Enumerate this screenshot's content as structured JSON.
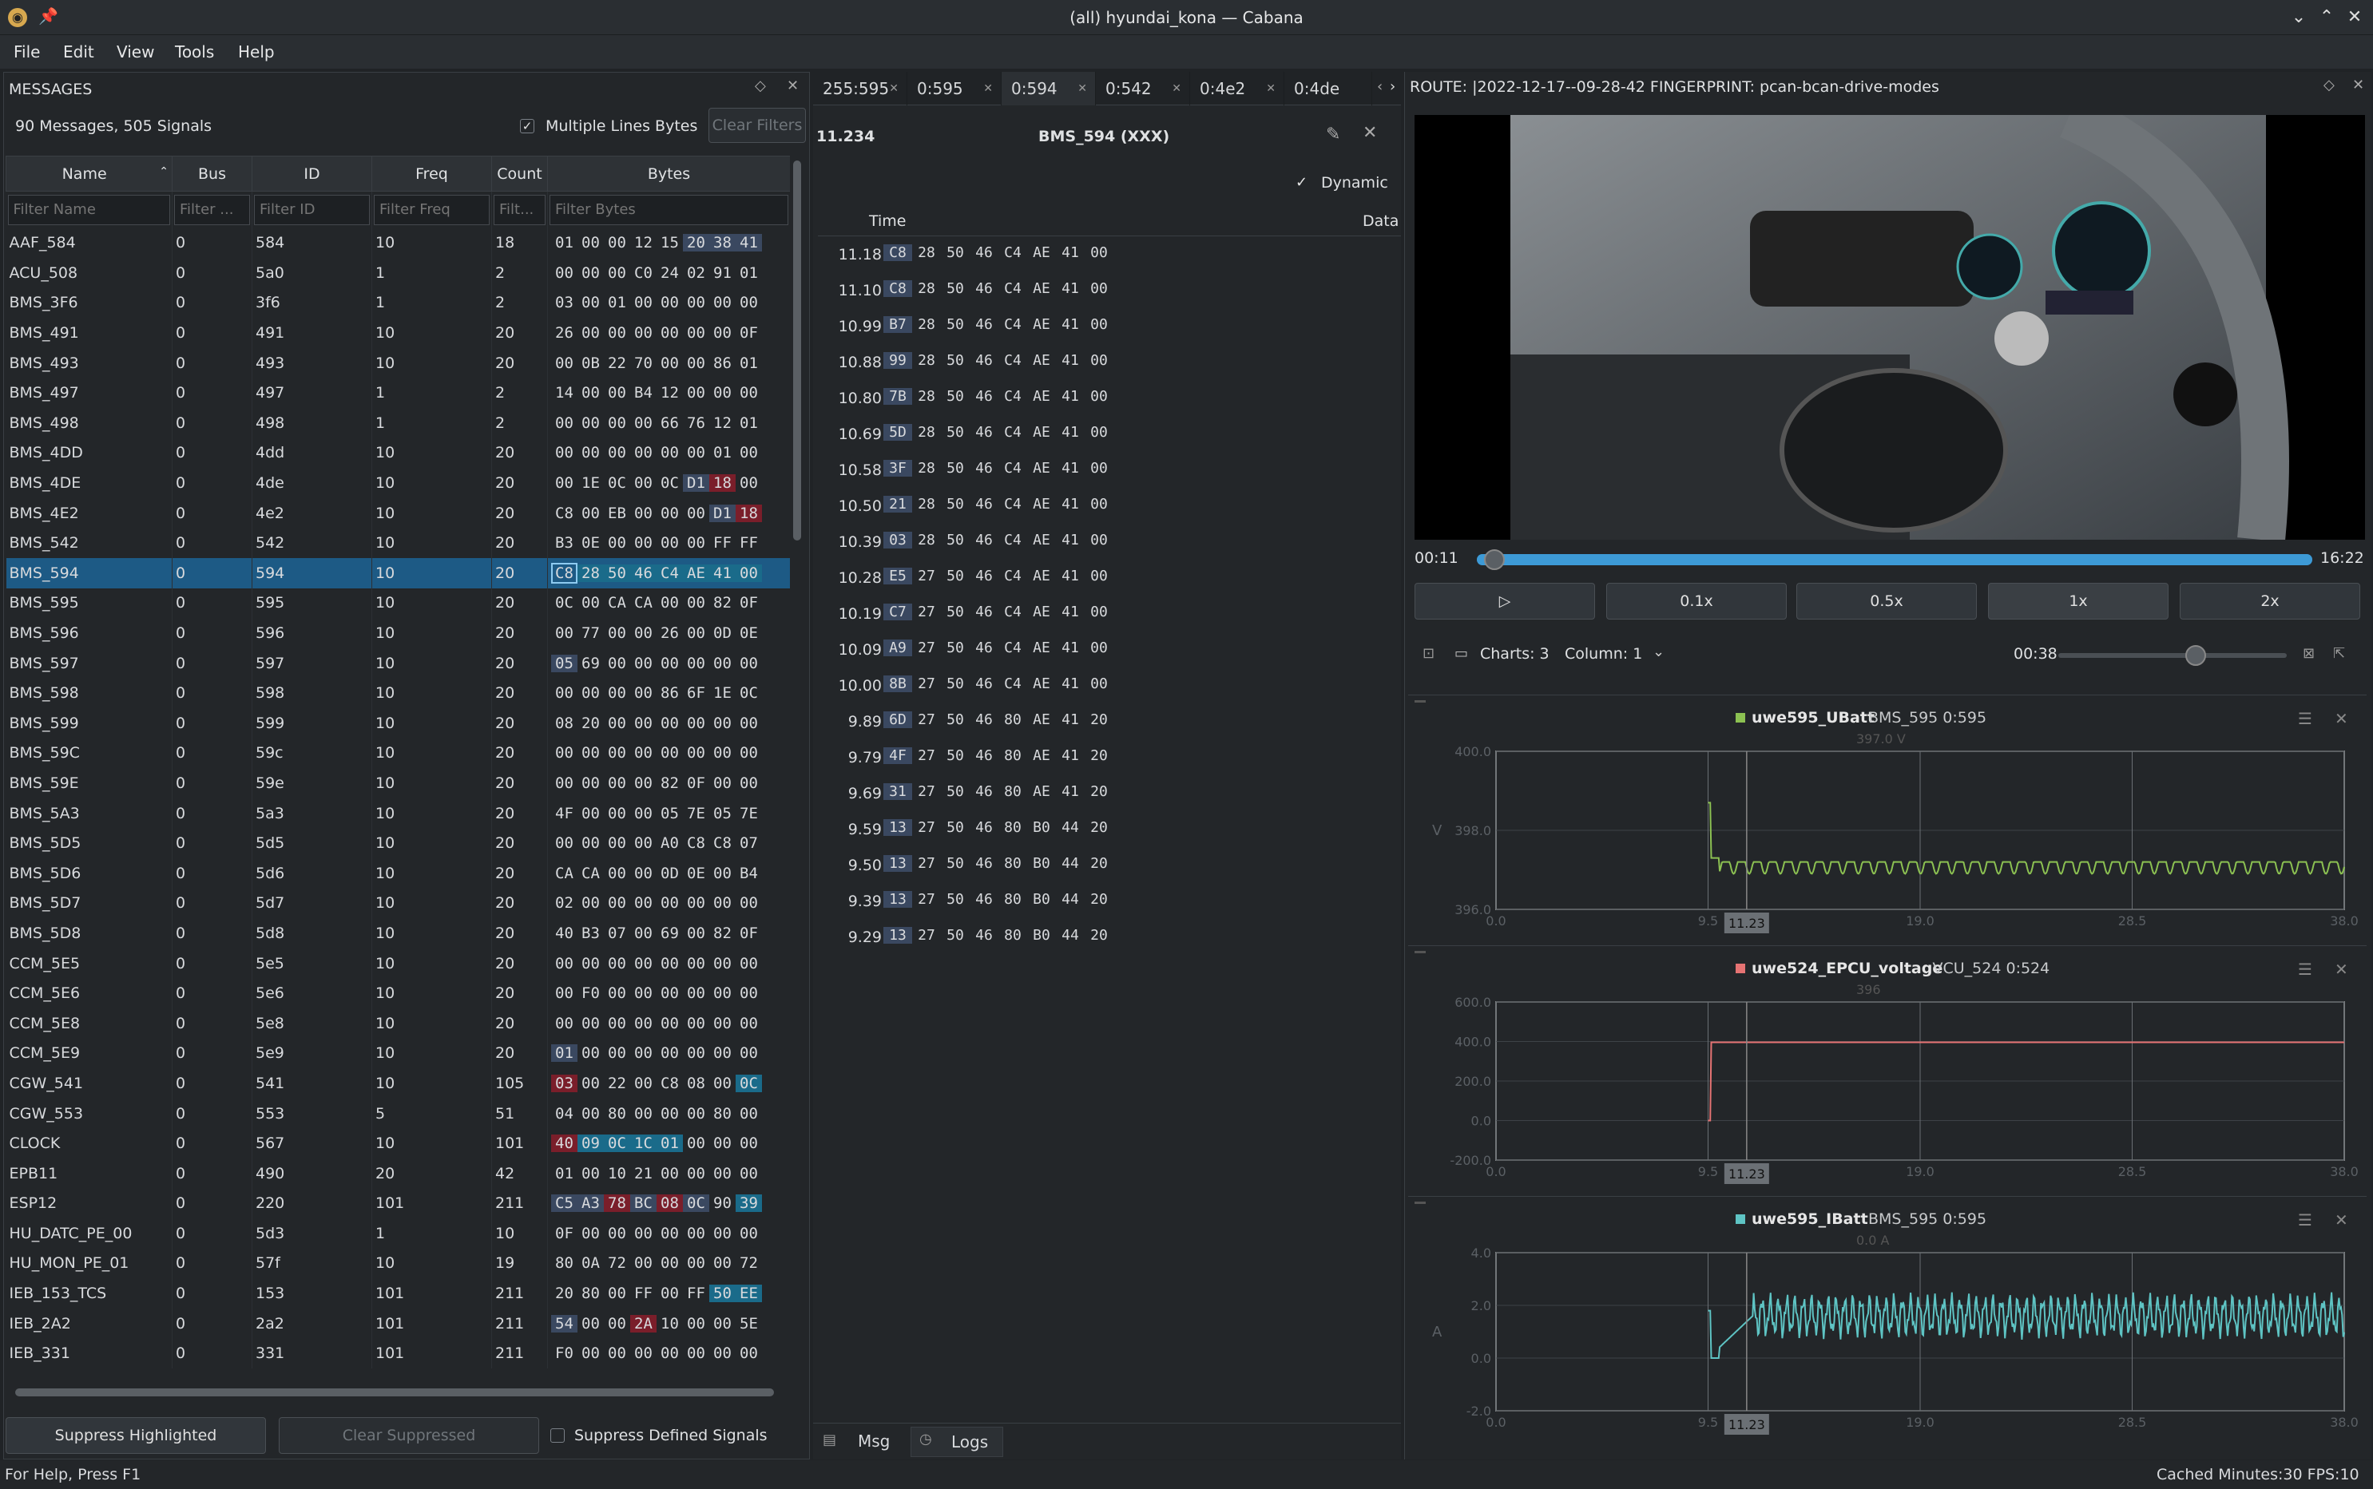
{
  "window": {
    "title": "(all) hyundai_kona — Cabana",
    "app_icon": "cabana-logo",
    "pin_icon": "pin-icon"
  },
  "menu": [
    "File",
    "Edit",
    "View",
    "Tools",
    "Help"
  ],
  "messages_panel": {
    "title": "MESSAGES",
    "summary": "90 Messages, 505 Signals",
    "multiline_label": "Multiple Lines Bytes",
    "clear_filters": "Clear Filters",
    "columns": [
      "Name",
      "Bus",
      "ID",
      "Freq",
      "Count",
      "Bytes"
    ],
    "filters": [
      "Filter Name",
      "Filter ...",
      "Filter ID",
      "Filter Freq",
      "Filt...",
      "Filter Bytes"
    ],
    "rows": [
      [
        "AAF_584",
        "0",
        "584",
        "10",
        "18",
        "01 00 00 12 15 20 38 41"
      ],
      [
        "ACU_508",
        "0",
        "5a0",
        "1",
        "2",
        "00 00 00 C0 24 02 91 01"
      ],
      [
        "BMS_3F6",
        "0",
        "3f6",
        "1",
        "2",
        "03 00 01 00 00 00 00 00"
      ],
      [
        "BMS_491",
        "0",
        "491",
        "10",
        "20",
        "26 00 00 00 00 00 00 0F"
      ],
      [
        "BMS_493",
        "0",
        "493",
        "10",
        "20",
        "00 0B 22 70 00 00 86 01"
      ],
      [
        "BMS_497",
        "0",
        "497",
        "1",
        "2",
        "14 00 00 B4 12 00 00 00"
      ],
      [
        "BMS_498",
        "0",
        "498",
        "1",
        "2",
        "00 00 00 00 66 76 12 01"
      ],
      [
        "BMS_4DD",
        "0",
        "4dd",
        "10",
        "20",
        "00 00 00 00 00 00 01 00"
      ],
      [
        "BMS_4DE",
        "0",
        "4de",
        "10",
        "20",
        "00 1E 0C 00 0C D1 18 00"
      ],
      [
        "BMS_4E2",
        "0",
        "4e2",
        "10",
        "20",
        "C8 00 EB 00 00 00 D1 18"
      ],
      [
        "BMS_542",
        "0",
        "542",
        "10",
        "20",
        "B3 0E 00 00 00 00 FF FF"
      ],
      [
        "BMS_594",
        "0",
        "594",
        "10",
        "20",
        "C8 28 50 46 C4 AE 41 00"
      ],
      [
        "BMS_595",
        "0",
        "595",
        "10",
        "20",
        "0C 00 CA CA 00 00 82 0F"
      ],
      [
        "BMS_596",
        "0",
        "596",
        "10",
        "20",
        "00 77 00 00 26 00 0D 0E"
      ],
      [
        "BMS_597",
        "0",
        "597",
        "10",
        "20",
        "05 69 00 00 00 00 00 00"
      ],
      [
        "BMS_598",
        "0",
        "598",
        "10",
        "20",
        "00 00 00 00 86 6F 1E 0C"
      ],
      [
        "BMS_599",
        "0",
        "599",
        "10",
        "20",
        "08 20 00 00 00 00 00 00"
      ],
      [
        "BMS_59C",
        "0",
        "59c",
        "10",
        "20",
        "00 00 00 00 00 00 00 00"
      ],
      [
        "BMS_59E",
        "0",
        "59e",
        "10",
        "20",
        "00 00 00 00 82 0F 00 00"
      ],
      [
        "BMS_5A3",
        "0",
        "5a3",
        "10",
        "20",
        "4F 00 00 00 05 7E 05 7E"
      ],
      [
        "BMS_5D5",
        "0",
        "5d5",
        "10",
        "20",
        "00 00 00 00 A0 C8 C8 07"
      ],
      [
        "BMS_5D6",
        "0",
        "5d6",
        "10",
        "20",
        "CA CA 00 00 0D 0E 00 B4"
      ],
      [
        "BMS_5D7",
        "0",
        "5d7",
        "10",
        "20",
        "02 00 00 00 00 00 00 00"
      ],
      [
        "BMS_5D8",
        "0",
        "5d8",
        "10",
        "20",
        "40 B3 07 00 69 00 82 0F"
      ],
      [
        "CCM_5E5",
        "0",
        "5e5",
        "10",
        "20",
        "00 00 00 00 00 00 00 00"
      ],
      [
        "CCM_5E6",
        "0",
        "5e6",
        "10",
        "20",
        "00 F0 00 00 00 00 00 00"
      ],
      [
        "CCM_5E8",
        "0",
        "5e8",
        "10",
        "20",
        "00 00 00 00 00 00 00 00"
      ],
      [
        "CCM_5E9",
        "0",
        "5e9",
        "10",
        "20",
        "01 00 00 00 00 00 00 00"
      ],
      [
        "CGW_541",
        "0",
        "541",
        "10",
        "105",
        "03 00 22 00 C8 08 00 0C"
      ],
      [
        "CGW_553",
        "0",
        "553",
        "5",
        "51",
        "04 00 80 00 00 00 80 00"
      ],
      [
        "CLOCK",
        "0",
        "567",
        "10",
        "101",
        "40 09 0C 1C 01 00 00 00"
      ],
      [
        "EPB11",
        "0",
        "490",
        "20",
        "42",
        "01 00 10 21 00 00 00 00"
      ],
      [
        "ESP12",
        "0",
        "220",
        "101",
        "211",
        "C5 A3 78 BC 08 0C 90 39"
      ],
      [
        "HU_DATC_PE_00",
        "0",
        "5d3",
        "1",
        "10",
        "0F 00 00 00 00 00 00 00"
      ],
      [
        "HU_MON_PE_01",
        "0",
        "57f",
        "10",
        "19",
        "80 0A 72 00 00 00 00 72"
      ],
      [
        "IEB_153_TCS",
        "0",
        "153",
        "101",
        "211",
        "20 80 00 FF 00 FF 50 EE"
      ],
      [
        "IEB_2A2",
        "0",
        "2a2",
        "101",
        "211",
        "54 00 00 2A 10 00 00 5E"
      ],
      [
        "IEB_331",
        "0",
        "331",
        "101",
        "211",
        "F0 00 00 00 00 00 00 00"
      ]
    ],
    "suppress_highlighted": "Suppress Highlighted",
    "clear_suppressed": "Clear Suppressed",
    "suppress_defined": "Suppress Defined Signals"
  },
  "tabs": [
    "255:595",
    "0:595",
    "0:594",
    "0:542",
    "0:4e2",
    "0:4de"
  ],
  "detail": {
    "time": "11.234",
    "title": "BMS_594 (XXX)",
    "dynamic": "Dynamic",
    "col_time": "Time",
    "col_data": "Data",
    "logs": [
      [
        "11.18",
        "C8 28 50 46 C4 AE 41 00"
      ],
      [
        "11.10",
        "C8 28 50 46 C4 AE 41 00"
      ],
      [
        "10.99",
        "B7 28 50 46 C4 AE 41 00"
      ],
      [
        "10.88",
        "99 28 50 46 C4 AE 41 00"
      ],
      [
        "10.80",
        "7B 28 50 46 C4 AE 41 00"
      ],
      [
        "10.69",
        "5D 28 50 46 C4 AE 41 00"
      ],
      [
        "10.58",
        "3F 28 50 46 C4 AE 41 00"
      ],
      [
        "10.50",
        "21 28 50 46 C4 AE 41 00"
      ],
      [
        "10.39",
        "03 28 50 46 C4 AE 41 00"
      ],
      [
        "10.28",
        "E5 27 50 46 C4 AE 41 00"
      ],
      [
        "10.19",
        "C7 27 50 46 C4 AE 41 00"
      ],
      [
        "10.09",
        "A9 27 50 46 C4 AE 41 00"
      ],
      [
        "10.00",
        "8B 27 50 46 C4 AE 41 00"
      ],
      [
        "9.89",
        "6D 27 50 46 80 AE 41 20"
      ],
      [
        "9.79",
        "4F 27 50 46 80 AE 41 20"
      ],
      [
        "9.69",
        "31 27 50 46 80 AE 41 20"
      ],
      [
        "9.59",
        "13 27 50 46 80 B0 44 20"
      ],
      [
        "9.50",
        "13 27 50 46 80 B0 44 20"
      ],
      [
        "9.39",
        "13 27 50 46 80 B0 44 20"
      ],
      [
        "9.29",
        "13 27 50 46 80 B0 44 20"
      ]
    ],
    "bottom_tabs": [
      "Msg",
      "Logs"
    ]
  },
  "video": {
    "route": "ROUTE: |2022-12-17--09-28-42  FINGERPRINT: pcan-bcan-drive-modes",
    "cur_time": "00:11",
    "end_time": "16:22",
    "progress": 0.012,
    "speeds": [
      "0.1x",
      "0.5x",
      "1x",
      "2x"
    ],
    "play_icon": "play-icon"
  },
  "charts_toolbar": {
    "charts": "Charts: 3",
    "column": "Column: 1",
    "time": "00:38",
    "zoom_level": 0.6
  },
  "charts": [
    {
      "signal": "uwe595_UBatt",
      "msg": "BMS_595 0:595",
      "color": "#8cc152",
      "cursor_value": "397.0 V",
      "ylabel": "V",
      "yticks": [
        "400.0",
        "398.0",
        "396.0"
      ],
      "ylim": [
        396,
        400
      ],
      "xticks": [
        "0.0",
        "9.5",
        "19.0",
        "28.5",
        "38.0"
      ],
      "cursor": "11.23"
    },
    {
      "signal": "uwe524_EPCU_voltage",
      "msg": "VCU_524 0:524",
      "color": "#e57373",
      "cursor_value": "396",
      "ylabel": "",
      "yticks": [
        "600.0",
        "400.0",
        "200.0",
        "0.0",
        "-200.0"
      ],
      "ylim": [
        -200,
        600
      ],
      "xticks": [
        "0.0",
        "9.5",
        "19.0",
        "28.5",
        "38.0"
      ],
      "cursor": "11.23"
    },
    {
      "signal": "uwe595_IBatt",
      "msg": "BMS_595 0:595",
      "color": "#5ec4c4",
      "cursor_value": "0.0 A",
      "ylabel": "A",
      "yticks": [
        "4.0",
        "2.0",
        "0.0",
        "-2.0"
      ],
      "ylim": [
        -2,
        4
      ],
      "xticks": [
        "0.0",
        "9.5",
        "19.0",
        "28.5",
        "38.0"
      ],
      "cursor": "11.23"
    }
  ],
  "status": {
    "help": "For Help, Press F1",
    "cache": "Cached Minutes:30 FPS:10"
  }
}
